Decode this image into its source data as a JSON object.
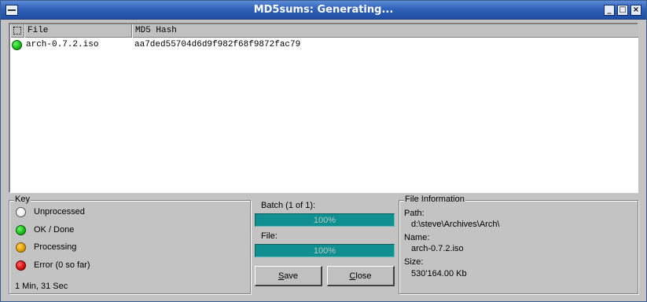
{
  "window": {
    "title": "MD5sums: Generating...",
    "controls": {
      "minimize": "_",
      "maximize": "□",
      "close": "×"
    }
  },
  "list": {
    "columns": {
      "file": "File",
      "hash": "MD5 Hash"
    },
    "rows": [
      {
        "status": "ok",
        "file": "arch-0.7.2.iso",
        "hash": "aa7ded55704d6d9f982f68f9872fac79"
      }
    ]
  },
  "key": {
    "title": "Key",
    "items": [
      {
        "label": "Unprocessed",
        "color": "#ffffff"
      },
      {
        "label": "OK / Done",
        "color": "#1bbf1b"
      },
      {
        "label": "Processing",
        "color": "#e2a20d"
      },
      {
        "label": "Error (0 so far)",
        "color": "#d81414"
      }
    ],
    "elapsed": "1 Min, 31 Sec"
  },
  "progress": {
    "batch_label": "Batch (1 of 1):",
    "batch_percent_text": "100%",
    "batch_fraction": 1.0,
    "file_label": "File:",
    "file_percent_text": "100%",
    "file_fraction": 1.0
  },
  "buttons": {
    "save_first": "S",
    "save_rest": "ave",
    "close_first": "C",
    "close_rest": "lose"
  },
  "file_info": {
    "title": "File Information",
    "path_label": "Path:",
    "path_value": "d:\\steve\\Archives\\Arch\\",
    "name_label": "Name:",
    "name_value": "arch-0.7.2.iso",
    "size_label": "Size:",
    "size_value": "530'164.00 Kb"
  }
}
